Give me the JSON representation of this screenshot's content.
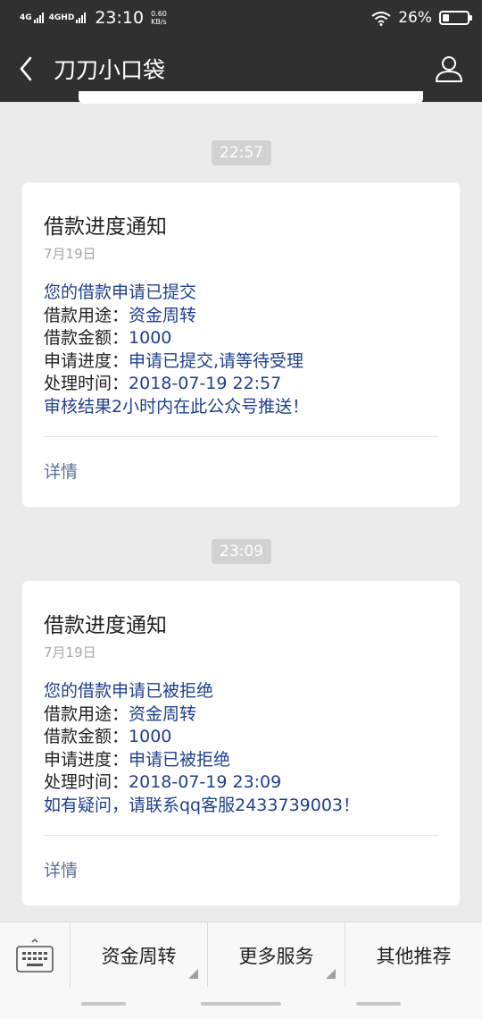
{
  "status_bar": {
    "net1": "4G",
    "net2": "4GHD",
    "time": "23:10",
    "speed_value": "0.60",
    "speed_unit": "KB/s",
    "battery_text": "26%",
    "battery_level": 0.26
  },
  "header": {
    "title": "刀刀小口袋",
    "back_icon": "chevron-left-icon",
    "profile_icon": "person-icon"
  },
  "messages": [
    {
      "time": "22:57",
      "title": "借款进度通知",
      "date": "7月19日",
      "first": "您的借款申请已提交",
      "rows": [
        {
          "label": "借款用途：",
          "value": "资金周转"
        },
        {
          "label": "借款金额：",
          "value": "1000"
        },
        {
          "label": "申请进度：",
          "value": "申请已提交,请等待受理"
        },
        {
          "label": "处理时间：",
          "value": "2018-07-19 22:57"
        }
      ],
      "remark": "审核结果2小时内在此公众号推送！",
      "detail": "详情"
    },
    {
      "time": "23:09",
      "title": "借款进度通知",
      "date": "7月19日",
      "first": "您的借款申请已被拒绝",
      "rows": [
        {
          "label": "借款用途：",
          "value": "资金周转"
        },
        {
          "label": "借款金额：",
          "value": "1000"
        },
        {
          "label": "申请进度：",
          "value": "申请已被拒绝"
        },
        {
          "label": "处理时间：",
          "value": "2018-07-19 23:09"
        }
      ],
      "remark": "如有疑问，请联系qq客服2433739003！",
      "detail": "详情"
    }
  ],
  "bottom_menu": {
    "keyboard_icon": "keyboard-icon",
    "items": [
      "资金周转",
      "更多服务",
      "其他推荐"
    ]
  },
  "colors": {
    "bar_bg": "#303030",
    "page_bg": "#ebebeb",
    "link_blue": "#1e3f8f"
  }
}
